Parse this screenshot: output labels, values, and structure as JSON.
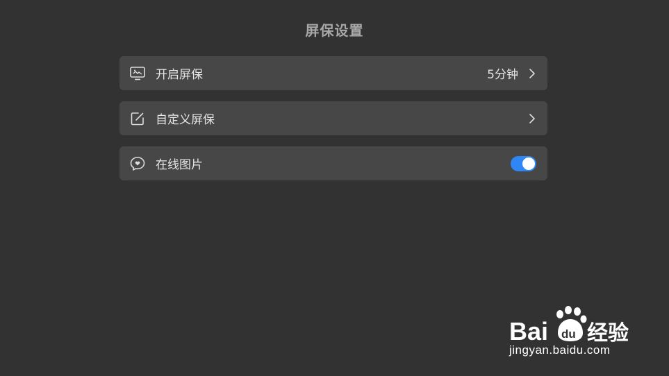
{
  "page": {
    "title": "屏保设置"
  },
  "settings": {
    "items": [
      {
        "label": "开启屏保",
        "value": "5分钟",
        "icon": "screen-icon",
        "control": "chevron"
      },
      {
        "label": "自定义屏保",
        "icon": "edit-icon",
        "control": "chevron"
      },
      {
        "label": "在线图片",
        "icon": "chat-heart-icon",
        "control": "toggle",
        "toggle_on": true
      }
    ]
  },
  "colors": {
    "background": "#323232",
    "row_background": "#474747",
    "toggle_on": "#2f86f5"
  },
  "watermark": {
    "logo_text": "Bai 经验",
    "url": "jingyan.baidu.com"
  }
}
